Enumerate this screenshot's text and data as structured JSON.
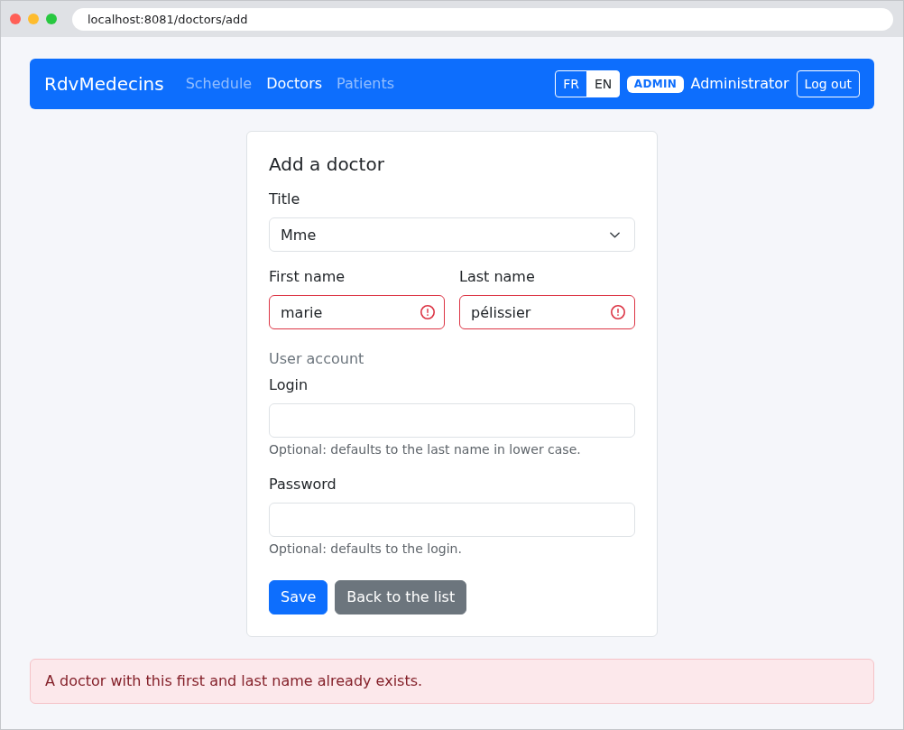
{
  "browser": {
    "url": "localhost:8081/doctors/add"
  },
  "navbar": {
    "brand": "RdvMedecins",
    "links": [
      {
        "label": "Schedule",
        "selected": false
      },
      {
        "label": "Doctors",
        "selected": true
      },
      {
        "label": "Patients",
        "selected": false
      }
    ],
    "languages": [
      {
        "label": "FR",
        "selected": false
      },
      {
        "label": "EN",
        "selected": true
      }
    ],
    "role_badge": "ADMIN",
    "user": "Administrator",
    "logout": "Log out"
  },
  "form": {
    "title": "Add a doctor",
    "title_field": {
      "label": "Title",
      "value": "Mme"
    },
    "name_fields": [
      {
        "label": "First name",
        "value": "marie",
        "invalid": true
      },
      {
        "label": "Last name",
        "value": "pélissier",
        "invalid": true
      }
    ],
    "section_heading": "User account",
    "account_fields": [
      {
        "label": "Login",
        "help": "Optional: defaults to the last name in lower case."
      },
      {
        "label": "Password",
        "help": "Optional: defaults to the login."
      }
    ],
    "buttons": [
      {
        "label": "Save",
        "kind": "primary"
      },
      {
        "label": "Back to the list",
        "kind": "secondary"
      }
    ]
  },
  "alert": {
    "kind": "danger",
    "message": "A doctor with this first and last name already exists."
  }
}
